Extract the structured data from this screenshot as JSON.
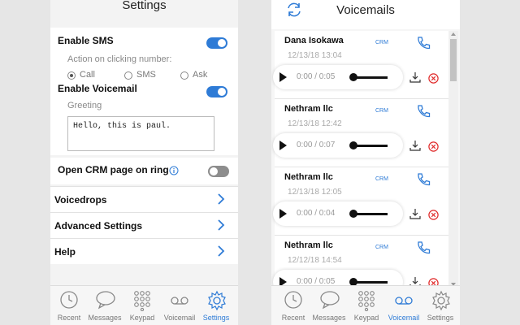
{
  "settings": {
    "title": "Settings",
    "enable_sms": "Enable SMS",
    "action_label": "Action on clicking number:",
    "radio": [
      "Call",
      "SMS",
      "Ask"
    ],
    "enable_voicemail": "Enable Voicemail",
    "greeting_label": "Greeting",
    "greeting_value": "Hello, this is paul.",
    "open_crm": "Open CRM page on ring",
    "rows": [
      "Voicedrops",
      "Advanced Settings",
      "Help"
    ]
  },
  "tabs": [
    "Recent",
    "Messages",
    "Keypad",
    "Voicemail",
    "Settings"
  ],
  "voicemails": {
    "title": "Voicemails",
    "crm_label": "CRM",
    "items": [
      {
        "name": "Dana Isokawa",
        "date": "12/13/18 13:04",
        "time": "0:00 / 0:05"
      },
      {
        "name": "Nethram llc",
        "date": "12/13/18 12:42",
        "time": "0:00 / 0:07"
      },
      {
        "name": "Nethram llc",
        "date": "12/13/18 12:05",
        "time": "0:00 / 0:04"
      },
      {
        "name": "Nethram llc",
        "date": "12/12/18 14:54",
        "time": "0:00 / 0:05"
      }
    ]
  },
  "colors": {
    "accent": "#2e7bd6",
    "delete": "#e02a2a"
  }
}
